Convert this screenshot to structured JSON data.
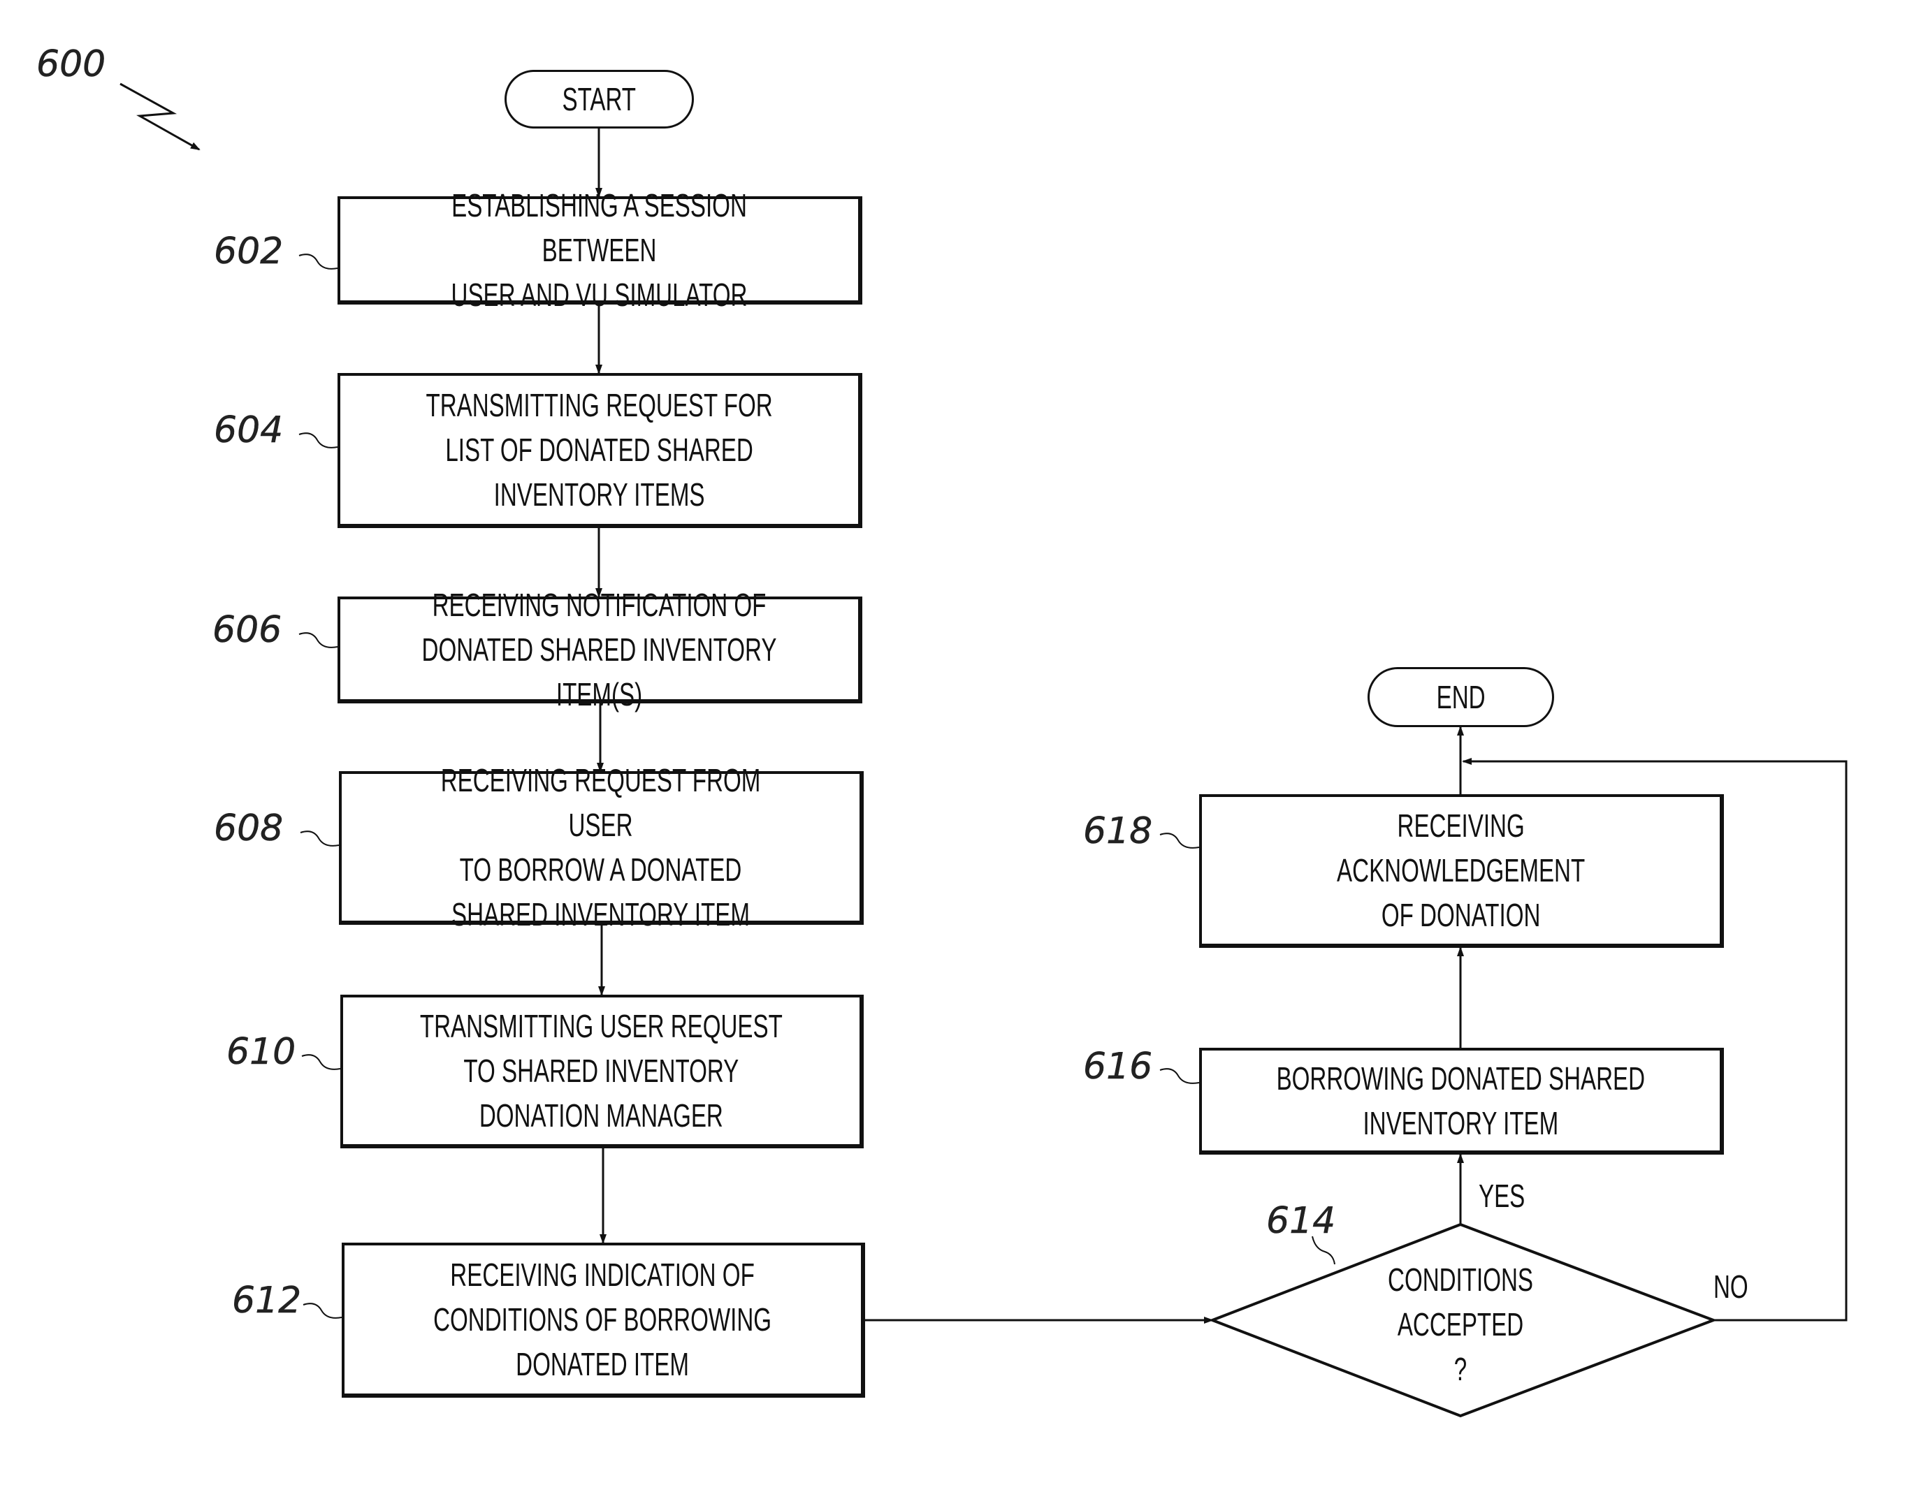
{
  "figure": {
    "ref": "600"
  },
  "terminals": {
    "start": "START",
    "end": "END"
  },
  "steps": [
    {
      "ref": "602",
      "text": "ESTABLISHING A SESSION BETWEEN\nUSER AND VU SIMULATOR"
    },
    {
      "ref": "604",
      "text": "TRANSMITTING REQUEST FOR\nLIST OF DONATED SHARED\nINVENTORY ITEMS"
    },
    {
      "ref": "606",
      "text": "RECEIVING NOTIFICATION OF\nDONATED SHARED INVENTORY ITEM(S)"
    },
    {
      "ref": "608",
      "text": "RECEIVING REQUEST FROM USER\nTO BORROW A DONATED\nSHARED INVENTORY ITEM"
    },
    {
      "ref": "610",
      "text": "TRANSMITTING USER REQUEST\nTO SHARED INVENTORY\nDONATION MANAGER"
    },
    {
      "ref": "612",
      "text": "RECEIVING INDICATION OF\nCONDITIONS OF BORROWING\nDONATED ITEM"
    },
    {
      "ref": "616",
      "text": "BORROWING DONATED SHARED\nINVENTORY ITEM"
    },
    {
      "ref": "618",
      "text": "RECEIVING\nACKNOWLEDGEMENT\nOF DONATION"
    }
  ],
  "decision": {
    "ref": "614",
    "text": "CONDITIONS\nACCEPTED\n?",
    "yes_label": "YES",
    "no_label": "NO"
  }
}
